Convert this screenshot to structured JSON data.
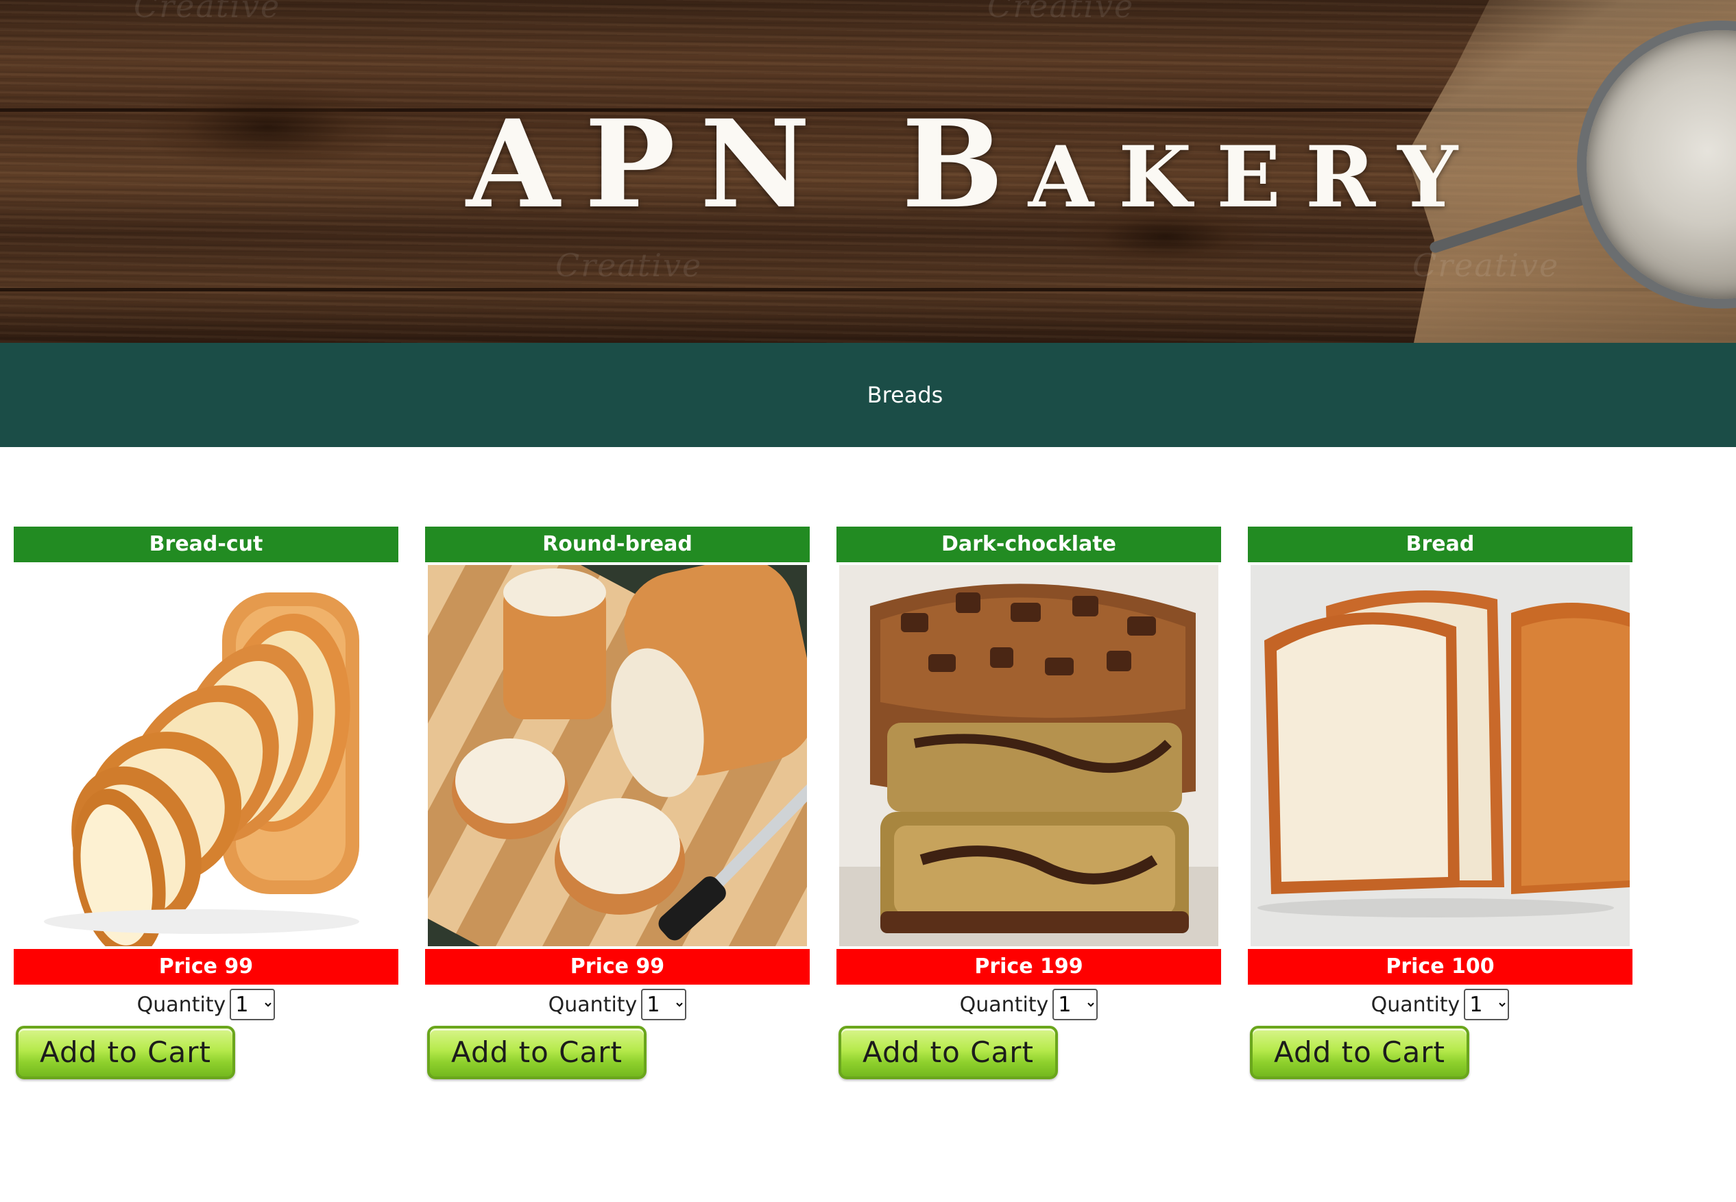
{
  "banner": {
    "title": "APN Bakery",
    "watermark_text": "Creative"
  },
  "nav": {
    "links": [
      {
        "label": "Breads"
      }
    ]
  },
  "products": [
    {
      "name": "Bread-cut",
      "price_label": "Price 99",
      "quantity_label": "Quantity",
      "quantity_selected": "1",
      "button_label": "Add to Cart",
      "image": "sliced-white-loaf"
    },
    {
      "name": "Round-bread",
      "price_label": "Price 99",
      "quantity_label": "Quantity",
      "quantity_selected": "1",
      "button_label": "Add to Cart",
      "image": "baguette-on-cutting-board"
    },
    {
      "name": "Dark-chocklate",
      "price_label": "Price 199",
      "quantity_label": "Quantity",
      "quantity_selected": "1",
      "button_label": "Add to Cart",
      "image": "chocolate-loaf-cake"
    },
    {
      "name": "Bread",
      "price_label": "Price 100",
      "quantity_label": "Quantity",
      "quantity_selected": "1",
      "button_label": "Add to Cart",
      "image": "sandwich-bread-slices"
    }
  ],
  "colors": {
    "nav_bg": "#1b4d47",
    "title_bar": "#228b22",
    "price_bar": "#ff0000",
    "button_green": "#b6ea4c"
  }
}
